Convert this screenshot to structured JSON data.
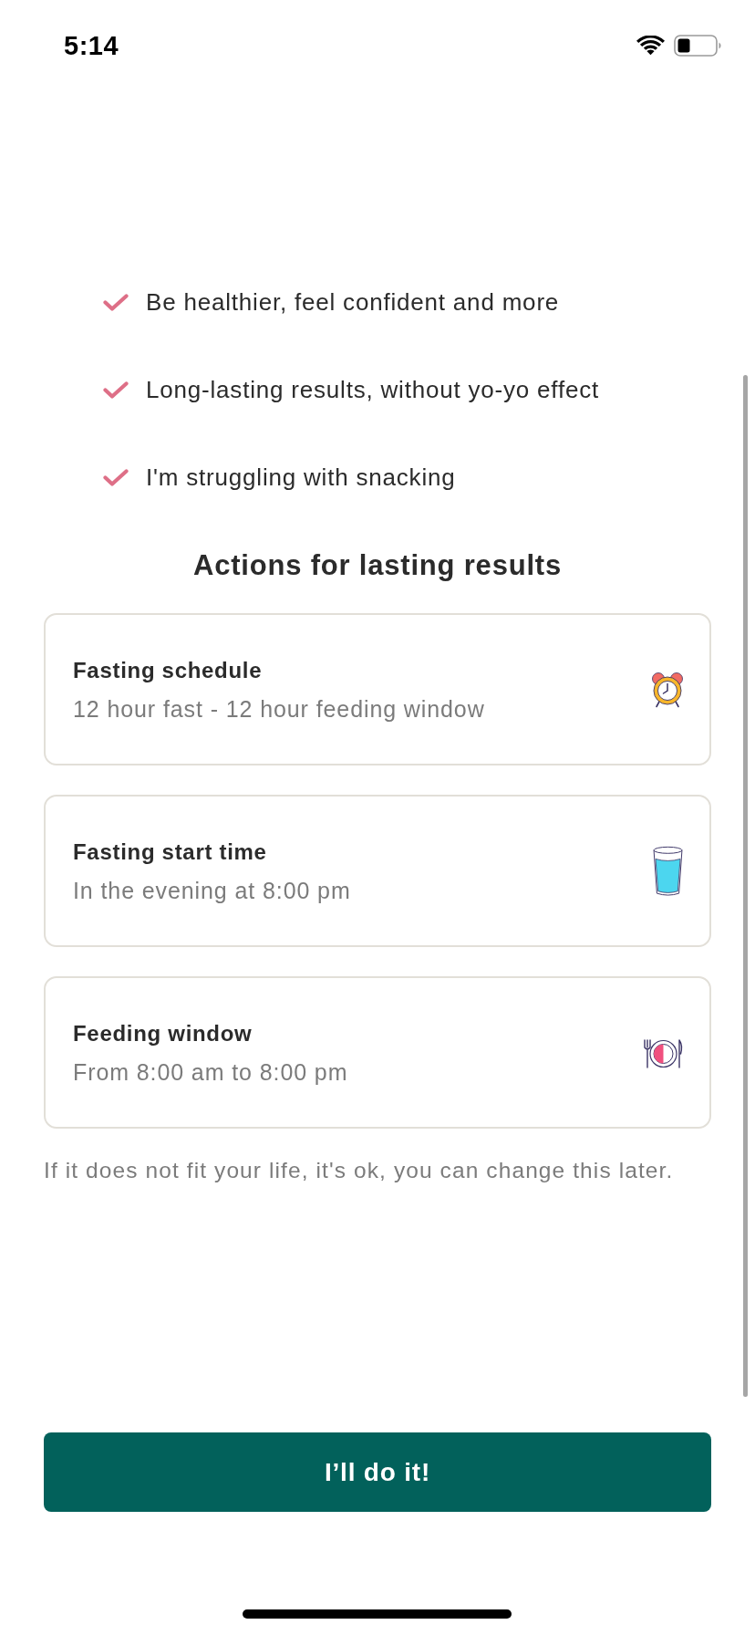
{
  "status_bar": {
    "time": "5:14"
  },
  "benefits": [
    {
      "text": "Be healthier, feel confident and more"
    },
    {
      "text": "Long-lasting results, without yo-yo effect"
    },
    {
      "text": "I'm struggling with snacking"
    }
  ],
  "section_title": "Actions for lasting results",
  "actions": [
    {
      "title": "Fasting schedule",
      "subtitle": "12 hour fast - 12 hour feeding window"
    },
    {
      "title": "Fasting start time",
      "subtitle": "In the evening at 8:00 pm"
    },
    {
      "title": "Feeding window",
      "subtitle": "From 8:00 am to 8:00 pm"
    }
  ],
  "note": "If it does not fit your life, it's ok, you can change this later.",
  "primary_button": {
    "label": "I’ll do it!"
  }
}
